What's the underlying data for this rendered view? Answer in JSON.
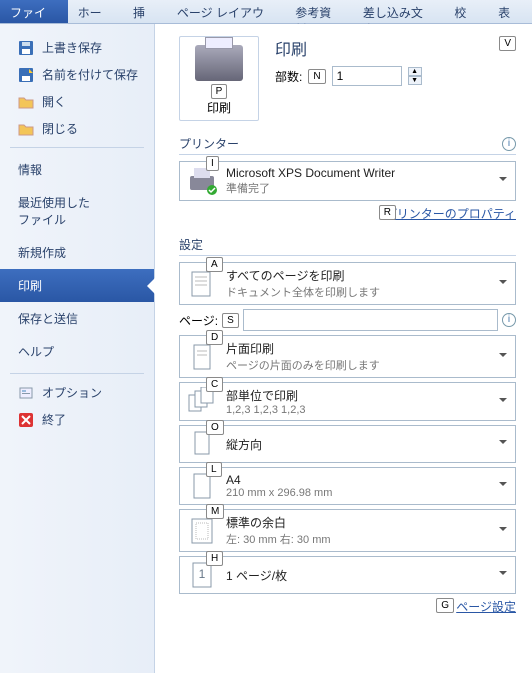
{
  "ribbon": {
    "tabs": [
      "ファイル",
      "ホーム",
      "挿入",
      "ページ レイアウト",
      "参考資料",
      "差し込み文書",
      "校閲",
      "表示"
    ],
    "active": 0
  },
  "sidebar": {
    "items": [
      {
        "icon": "save",
        "label": "上書き保存"
      },
      {
        "icon": "saveas",
        "label": "名前を付けて保存"
      },
      {
        "icon": "open",
        "label": "開く"
      },
      {
        "icon": "close",
        "label": "閉じる"
      }
    ],
    "sections": [
      "情報",
      "最近使用した\nファイル",
      "新規作成",
      "印刷",
      "保存と送信",
      "ヘルプ"
    ],
    "selected": 3,
    "bottom": [
      {
        "icon": "options",
        "label": "オプション"
      },
      {
        "icon": "exit",
        "label": "終了"
      }
    ]
  },
  "print": {
    "title": "印刷",
    "button_label": "印刷",
    "button_key": "P",
    "top_key": "V",
    "copies_label": "部数:",
    "copies_key": "N",
    "copies_value": "1"
  },
  "printer": {
    "heading": "プリンター",
    "key": "I",
    "name": "Microsoft XPS Document Writer",
    "status": "準備完了",
    "props_key": "R",
    "props_link": "プリンターのプロパティ"
  },
  "settings": {
    "heading": "設定",
    "range": {
      "key": "A",
      "primary": "すべてのページを印刷",
      "secondary": "ドキュメント全体を印刷します"
    },
    "pages": {
      "key": "S",
      "label": "ページ:",
      "value": ""
    },
    "sides": {
      "key": "D",
      "primary": "片面印刷",
      "secondary": "ページの片面のみを印刷します"
    },
    "collate": {
      "key": "C",
      "primary": "部単位で印刷",
      "secondary": "1,2,3   1,2,3   1,2,3"
    },
    "orient": {
      "key": "O",
      "primary": "縦方向"
    },
    "paper": {
      "key": "L",
      "primary": "A4",
      "secondary": "210 mm x 296.98 mm"
    },
    "margins": {
      "key": "M",
      "primary": "標準の余白",
      "secondary": "左: 30 mm  右: 30 mm"
    },
    "sheets": {
      "key": "H",
      "primary": "1 ページ/枚"
    },
    "page_setup": {
      "key": "G",
      "link": "ページ設定"
    }
  }
}
